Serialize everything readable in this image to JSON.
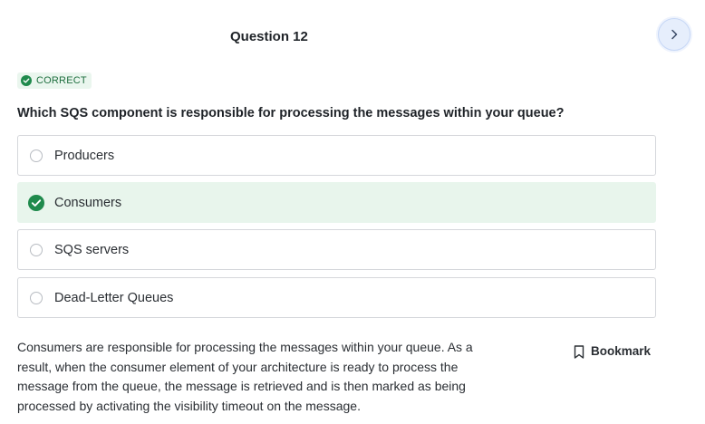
{
  "header": {
    "question_title": "Question 12",
    "next_icon": "chevron-right-icon"
  },
  "status": {
    "label": "CORRECT",
    "icon": "check-circle-icon",
    "color": "#1f8a4c"
  },
  "question": {
    "prompt": "Which SQS component is responsible for processing the messages within your queue?",
    "options": [
      {
        "label": "Producers",
        "selected": false
      },
      {
        "label": "Consumers",
        "selected": true
      },
      {
        "label": "SQS servers",
        "selected": false
      },
      {
        "label": "Dead-Letter Queues",
        "selected": false
      }
    ]
  },
  "explanation": {
    "text": "Consumers are responsible for processing the messages within your queue. As a result, when the consumer element of your architecture is ready to process the message from the queue, the message is retrieved and is then marked as being processed by activating the visibility timeout on the message."
  },
  "bookmark": {
    "label": "Bookmark",
    "icon": "bookmark-icon"
  },
  "colors": {
    "accent_green": "#1f8a4c",
    "selected_bg": "#e8f5ec",
    "next_button_bg": "#e6eefc"
  }
}
